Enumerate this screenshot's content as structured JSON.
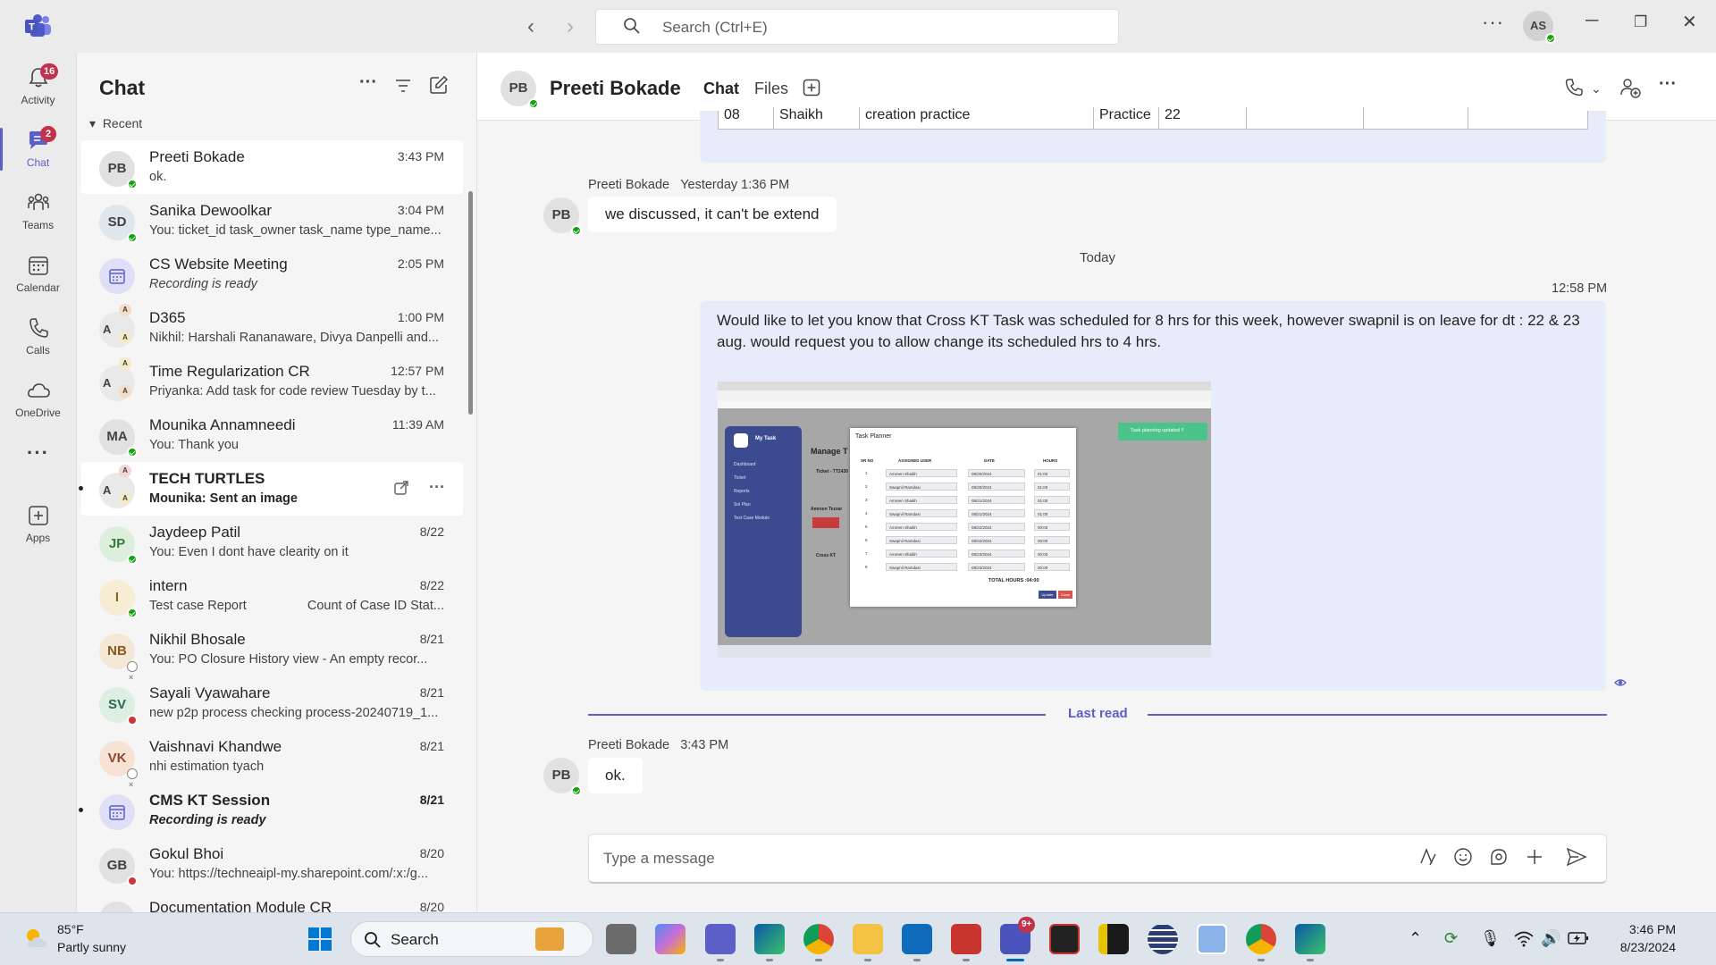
{
  "titlebar": {
    "search_placeholder": "Search (Ctrl+E)",
    "more": "···",
    "user_initials": "AS"
  },
  "rail": {
    "items": [
      {
        "label": "Activity",
        "badge": "16",
        "icon": "bell-icon"
      },
      {
        "label": "Chat",
        "badge": "2",
        "icon": "chat-icon"
      },
      {
        "label": "Teams",
        "icon": "teams-icon"
      },
      {
        "label": "Calendar",
        "icon": "calendar-icon"
      },
      {
        "label": "Calls",
        "icon": "phone-icon"
      },
      {
        "label": "OneDrive",
        "icon": "cloud-icon"
      },
      {
        "label": "···",
        "icon": "more-icon"
      },
      {
        "label": "Apps",
        "icon": "apps-icon"
      }
    ]
  },
  "chatlist": {
    "title": "Chat",
    "section": "Recent",
    "items": [
      {
        "initials": "PB",
        "name": "Preeti Bokade",
        "time": "3:43 PM",
        "preview": "ok.",
        "presence": "available",
        "avatar_bg": "#e1e1e1"
      },
      {
        "initials": "SD",
        "name": "Sanika Dewoolkar",
        "time": "3:04 PM",
        "preview": "You: ticket_id task_owner task_name type_name...",
        "presence": "available",
        "avatar_bg": "#dfe6ec"
      },
      {
        "initials": "",
        "name": "CS Website Meeting",
        "time": "2:05 PM",
        "preview": "Recording is ready",
        "presence": "",
        "avatar_bg": "#dfe0f7"
      },
      {
        "initials": "A",
        "name": "D365",
        "time": "1:00 PM",
        "preview": "Nikhil: Harshali Rananaware, Divya Danpelli and...",
        "presence": "",
        "avatar_bg": "#e9e9e9"
      },
      {
        "initials": "A",
        "name": "Time Regularization CR",
        "time": "12:57 PM",
        "preview": "Priyanka: Add task for code review Tuesday by t...",
        "presence": "",
        "avatar_bg": "#e9e9e9"
      },
      {
        "initials": "MA",
        "name": "Mounika Annamneedi",
        "time": "11:39 AM",
        "preview": "You: Thank you",
        "presence": "available",
        "avatar_bg": "#e1e1e1"
      },
      {
        "initials": "A",
        "name": "TECH TURTLES",
        "time": "",
        "preview": "Mounika: Sent an image",
        "presence": "",
        "avatar_bg": "#e9e9e9"
      },
      {
        "initials": "JP",
        "name": "Jaydeep Patil",
        "time": "8/22",
        "preview": "You: Even I dont have clearity on it",
        "presence": "available",
        "avatar_bg": "#dcefdc"
      },
      {
        "initials": "I",
        "name": "intern",
        "time": "8/22",
        "preview": "Test case Report",
        "preview_right": "Count of Case ID Stat...",
        "presence": "available",
        "avatar_bg": "#f7ecd4"
      },
      {
        "initials": "NB",
        "name": "Nikhil Bhosale",
        "time": "8/21",
        "preview": "You: PO Closure History view - An empty recor...",
        "presence": "away",
        "avatar_bg": "#f5e7d6"
      },
      {
        "initials": "SV",
        "name": "Sayali Vyawahare",
        "time": "8/21",
        "preview": "new p2p process checking process-20240719_1...",
        "presence": "busy",
        "avatar_bg": "#dcefe2"
      },
      {
        "initials": "VK",
        "name": "Vaishnavi Khandwe",
        "time": "8/21",
        "preview": "nhi estimation tyach",
        "presence": "away",
        "avatar_bg": "#f7e3d6"
      },
      {
        "initials": "",
        "name": "CMS KT Session",
        "time": "8/21",
        "preview": "Recording is ready",
        "presence": "",
        "avatar_bg": "#dfe0f7"
      },
      {
        "initials": "GB",
        "name": "Gokul Bhoi",
        "time": "8/20",
        "preview": "You: https://techneaipl-my.sharepoint.com/:x:/g...",
        "presence": "busy",
        "avatar_bg": "#e1e1e1"
      },
      {
        "initials": "",
        "name": "Documentation Module CR",
        "time": "8/20",
        "preview": "",
        "presence": "",
        "avatar_bg": "#e1e1e1"
      }
    ]
  },
  "main": {
    "contact_initials": "PB",
    "contact_name": "Preeti Bokade",
    "tabs": [
      "Chat",
      "Files"
    ],
    "table_fragment": {
      "cells": [
        "08",
        "Shaikh",
        "creation practice",
        "Practice",
        "22",
        "",
        "",
        ""
      ]
    },
    "messages": [
      {
        "sender": "Preeti Bokade",
        "time": "Yesterday 1:36 PM",
        "text": "we discussed, it can't be extend"
      },
      {
        "sender": "Preeti Bokade",
        "time": "3:43 PM",
        "text": "ok."
      }
    ],
    "date_divider": "Today",
    "my_message": {
      "time": "12:58 PM",
      "text": "Would like to let you know that Cross KT Task was scheduled for 8 hrs for this week, however swapnil is on leave for dt : 22 & 23 aug. would request you to allow change its scheduled hrs to 4 hrs."
    },
    "screenshot": {
      "sidebar_title": "My Task",
      "sidebar_items": [
        "Dashboard",
        "Ticket",
        "Reports",
        "Sol Plan",
        "Test Case Module"
      ],
      "page_title": "Manage T",
      "ticket_label": "Ticket - TT2430",
      "modal_title": "Task Planner",
      "columns": [
        "SR NO",
        "ASSIGNED USER",
        "DATE",
        "HOURS"
      ],
      "rows": [
        {
          "no": "1",
          "user": "Amreen Shaikh",
          "date": "08/20/2024",
          "hours": "01:00"
        },
        {
          "no": "2",
          "user": "Swapnil Ramdasi",
          "date": "08/20/2024",
          "hours": "01:00"
        },
        {
          "no": "3",
          "user": "Amreen Shaikh",
          "date": "08/21/2024",
          "hours": "01:00"
        },
        {
          "no": "4",
          "user": "Swapnil Ramdasi",
          "date": "08/21/2024",
          "hours": "01:00"
        },
        {
          "no": "5",
          "user": "Amreen Shaikh",
          "date": "08/22/2024",
          "hours": "00:00"
        },
        {
          "no": "6",
          "user": "Swapnil Ramdasi",
          "date": "08/22/2024",
          "hours": "00:00"
        },
        {
          "no": "7",
          "user": "Amreen Shaikh",
          "date": "08/23/2024",
          "hours": "00:00"
        },
        {
          "no": "8",
          "user": "Swapnil Ramdasi",
          "date": "08/23/2024",
          "hours": "00:00"
        }
      ],
      "total": "TOTAL HOURS :04:00",
      "toast": "Task planning updated !!",
      "update_btn": "Update",
      "close_btn": "Close",
      "card_name": "Cross KT",
      "person": "Amreen Tezzar"
    },
    "last_read": "Last read",
    "composer_placeholder": "Type a message"
  },
  "taskbar": {
    "weather_temp": "85°F",
    "weather_desc": "Partly sunny",
    "search_label": "Search",
    "teams_badge": "9+",
    "clock_time": "3:46 PM",
    "clock_date": "8/23/2024"
  },
  "colors": {
    "accent": "#5b5fc7",
    "available": "#13a10e",
    "busy": "#d13438",
    "badge": "#c4314b"
  }
}
